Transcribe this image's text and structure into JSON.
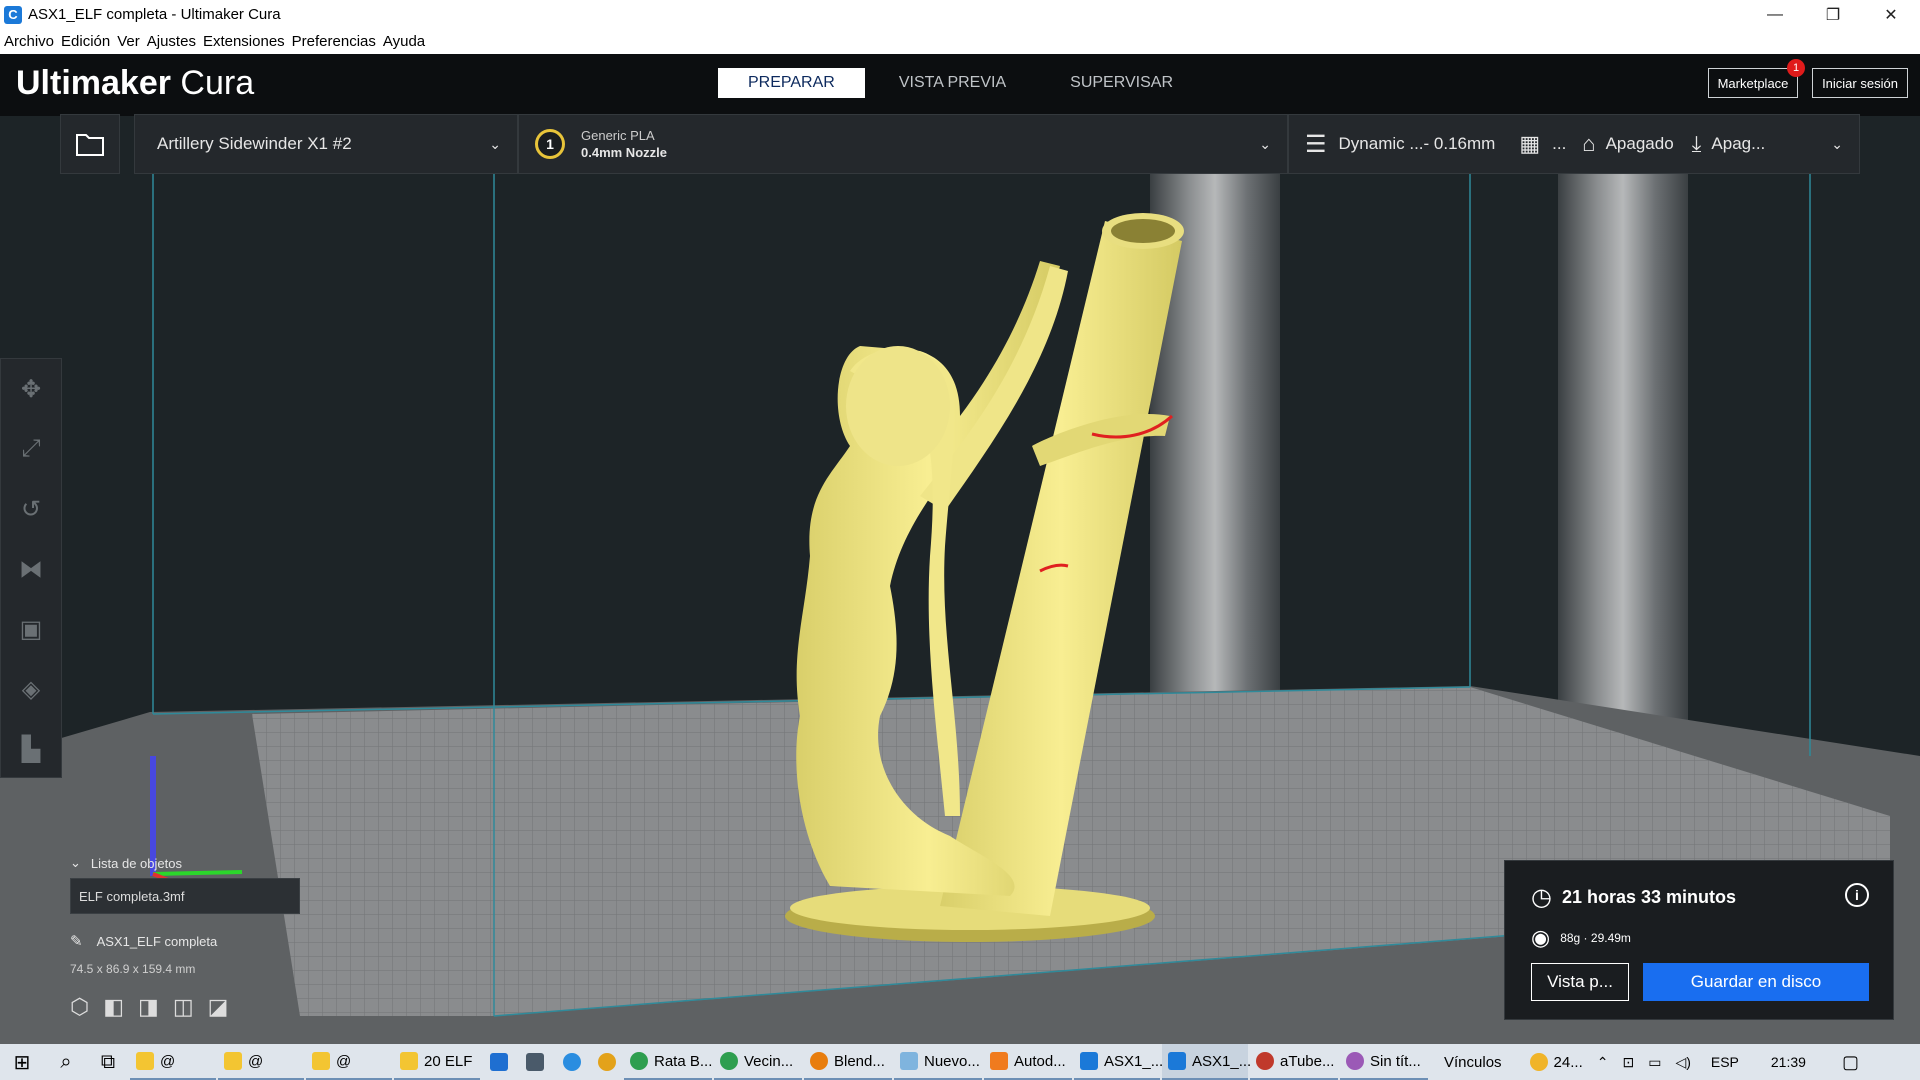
{
  "window": {
    "title": "ASX1_ELF completa - Ultimaker Cura",
    "minimize": "—",
    "maximize": "❐",
    "close": "✕"
  },
  "menu": [
    "Archivo",
    "Edición",
    "Ver",
    "Ajustes",
    "Extensiones",
    "Preferencias",
    "Ayuda"
  ],
  "header": {
    "logo_bold": "Ultimaker",
    "logo_light": "Cura",
    "stages": [
      "PREPARAR",
      "VISTA PREVIA",
      "SUPERVISAR"
    ],
    "marketplace": "Marketplace",
    "marketplace_badge": "1",
    "signin": "Iniciar sesión"
  },
  "machine": {
    "printer": "Artillery Sidewinder X1 #2",
    "extruder_number": "1",
    "material": "Generic PLA",
    "nozzle": "0.4mm Nozzle",
    "profile": "Dynamic ...- 0.16mm",
    "support_ellipsis": "...",
    "adhesion": "Apagado",
    "save_short": "Apag..."
  },
  "objects": {
    "header": "Lista de objetos",
    "items": [
      "ELF completa.3mf"
    ],
    "model_name": "ASX1_ELF completa",
    "dimensions": "74.5 x 86.9 x 159.4 mm"
  },
  "print": {
    "time": "21 horas 33 minutos",
    "material": "88g · 29.49m",
    "preview_button": "Vista p...",
    "save_button": "Guardar en disco"
  },
  "taskbar": {
    "items": [
      "@",
      "@",
      "@",
      "20 ELF",
      "Rata B...",
      "Vecin...",
      "Blend...",
      "Nuevo...",
      "Autod...",
      "ASX1_...",
      "ASX1_...",
      "aTube...",
      "Sin tít..."
    ],
    "links": "Vínculos",
    "weather": "24...",
    "lang": "ESP",
    "clock": "21:39"
  },
  "colors": {
    "accent": "#196ef0",
    "model": "#f4ea8a",
    "header_bg": "#0c0e10"
  }
}
